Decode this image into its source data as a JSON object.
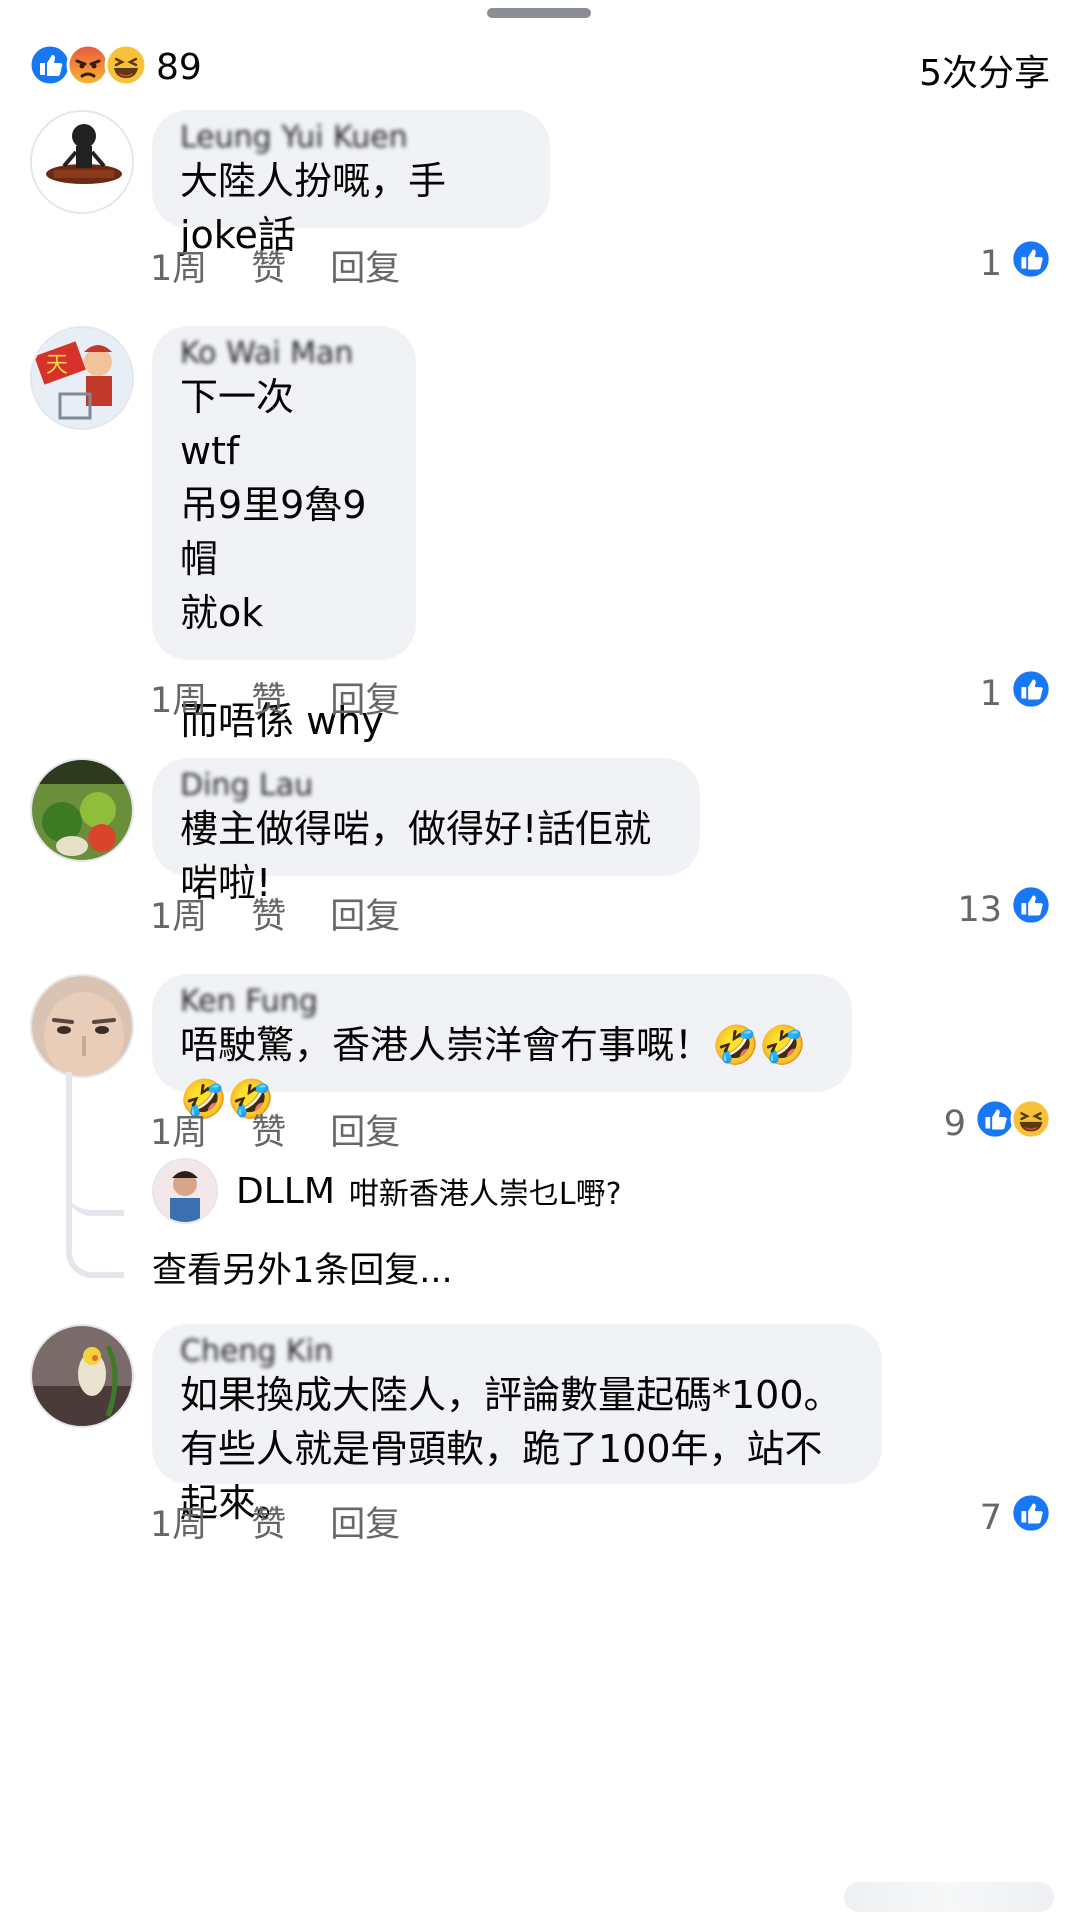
{
  "topbar": {
    "reaction_icons": [
      "like-icon",
      "angry-icon",
      "haha-icon"
    ],
    "reaction_count": "89",
    "shares": "5次分享"
  },
  "colors": {
    "like_blue": "#1877f2",
    "bubble": "#f0f2f5",
    "meta_gray": "#65676b"
  },
  "comments": [
    {
      "author": "Leung Yui Kuen",
      "text": "大陸人扮嘅，手joke話",
      "time": "1周",
      "like_label": "赞",
      "reply_label": "回复",
      "like_count": "1",
      "reaction_icons": [
        "like-icon"
      ]
    },
    {
      "author": "Ko Wai Man",
      "text": "下一次\nwtf\n吊9里9魯9帽\n就ok\n\n而唔係 why",
      "time": "1周",
      "like_label": "赞",
      "reply_label": "回复",
      "like_count": "1",
      "reaction_icons": [
        "like-icon"
      ]
    },
    {
      "author": "Ding Lau",
      "text": "樓主做得啱，做得好!話佢就啱啦!",
      "time": "1周",
      "like_label": "赞",
      "reply_label": "回复",
      "like_count": "13",
      "reaction_icons": [
        "like-icon"
      ]
    },
    {
      "author": "Ken Fung",
      "text": "唔駛驚，香港人崇洋會冇事嘅！🤣🤣🤣🤣",
      "time": "1周",
      "like_label": "赞",
      "reply_label": "回复",
      "like_count": "9",
      "reaction_icons": [
        "like-icon",
        "haha-icon"
      ]
    },
    {
      "author": "Cheng Kin",
      "text": "如果換成大陸人，評論數量起碼*100。有些人就是骨頭軟，跪了100年，站不起來。",
      "time": "1周",
      "like_label": "赞",
      "reply_label": "回复",
      "like_count": "7",
      "reaction_icons": [
        "like-icon"
      ]
    }
  ],
  "reply": {
    "name": "DLLM",
    "text": "咁新香港人崇乜L嘢?"
  },
  "more_replies": "查看另外1条回复..."
}
